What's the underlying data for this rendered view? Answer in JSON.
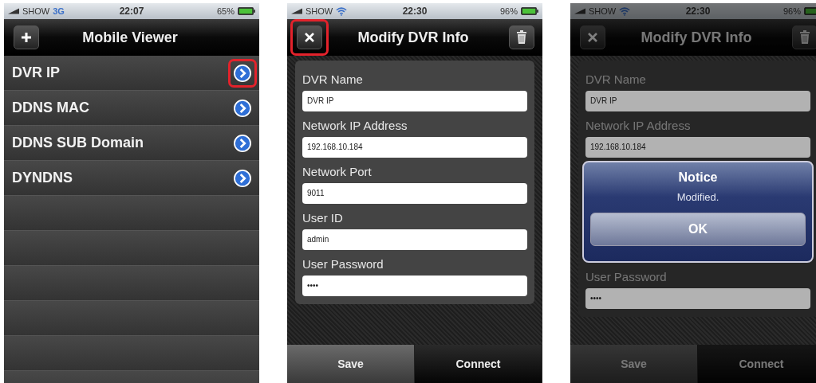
{
  "screens": [
    {
      "kind": "list",
      "dimmed": false,
      "status": {
        "carrier": "SHOW",
        "network": {
          "kind": "text",
          "label": "3G"
        },
        "time": "22:07",
        "battery": "65%"
      },
      "nav": {
        "left": {
          "kind": "add",
          "highlighted": false
        },
        "title": "Mobile Viewer"
      },
      "rows": [
        {
          "label": "DVR IP",
          "highlighted": true
        },
        {
          "label": "DDNS MAC",
          "highlighted": false
        },
        {
          "label": "DDNS SUB Domain",
          "highlighted": false
        },
        {
          "label": "DYNDNS",
          "highlighted": false
        }
      ]
    },
    {
      "kind": "form",
      "dimmed": false,
      "status": {
        "carrier": "SHOW",
        "network": {
          "kind": "wifi"
        },
        "time": "22:30",
        "battery": "96%"
      },
      "nav": {
        "left": {
          "kind": "close",
          "highlighted": true
        },
        "title": "Modify DVR Info",
        "right": {
          "kind": "delete"
        }
      },
      "fields": [
        {
          "label": "DVR Name",
          "value": "DVR IP"
        },
        {
          "label": "Network IP Address",
          "value": "192.168.10.184"
        },
        {
          "label": "Network Port",
          "value": "9011"
        },
        {
          "label": "User ID",
          "value": "admin"
        },
        {
          "label": "User Password",
          "value": "••••"
        }
      ],
      "buttons": [
        {
          "label": "Save",
          "selected": false
        },
        {
          "label": "Connect",
          "selected": true
        }
      ]
    },
    {
      "kind": "form",
      "dimmed": true,
      "status": {
        "carrier": "SHOW",
        "network": {
          "kind": "wifi"
        },
        "time": "22:30",
        "battery": "96%"
      },
      "nav": {
        "left": {
          "kind": "close",
          "highlighted": false
        },
        "title": "Modify DVR Info",
        "right": {
          "kind": "delete"
        }
      },
      "fields": [
        {
          "label": "DVR Name",
          "value": "DVR IP"
        },
        {
          "label": "Network IP Address",
          "value": "192.168.10.184"
        },
        {
          "label": "User Password",
          "value": "••••"
        }
      ],
      "alert": {
        "title": "Notice",
        "message": "Modified.",
        "button": "OK"
      },
      "buttons": [
        {
          "label": "Save",
          "selected": false
        },
        {
          "label": "Connect",
          "selected": true
        }
      ]
    }
  ]
}
